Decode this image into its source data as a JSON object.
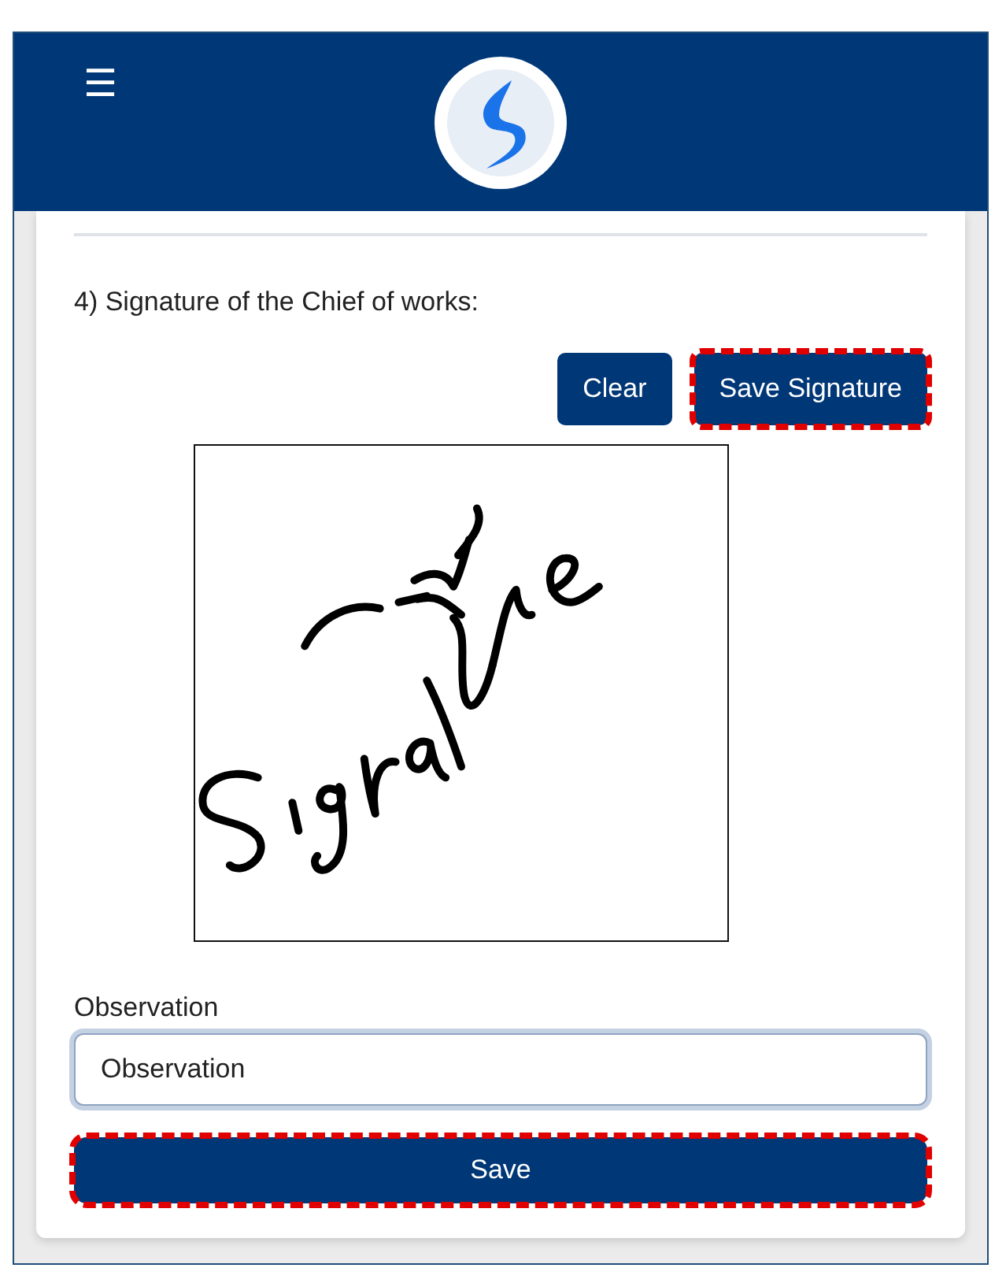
{
  "header": {
    "menu_icon": "☰"
  },
  "signature_section": {
    "label": "4) Signature of the Chief of works:",
    "buttons": [
      {
        "label": "Clear",
        "highlighted": false
      },
      {
        "label": "Save Signature",
        "highlighted": true
      }
    ]
  },
  "observation": {
    "label": "Observation",
    "value": "Observation",
    "focused": true
  },
  "save_button": {
    "label": "Save",
    "highlighted": true
  }
}
